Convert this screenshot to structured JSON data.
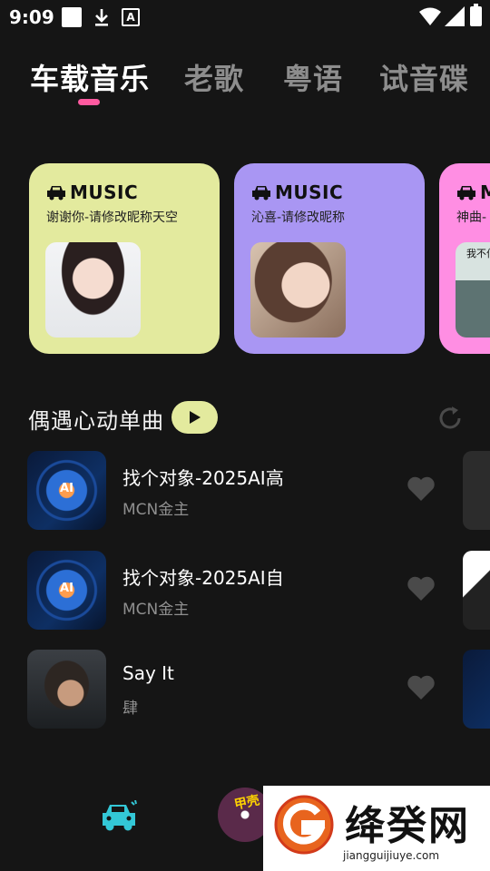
{
  "status_bar": {
    "time": "9:09",
    "icons": [
      "notification-square-icon",
      "download-icon",
      "text-a-icon",
      "wifi-icon",
      "signal-icon",
      "battery-icon"
    ]
  },
  "tabs": [
    {
      "label": "车载音乐",
      "active": true
    },
    {
      "label": "老歌",
      "active": false
    },
    {
      "label": "粤语",
      "active": false
    },
    {
      "label": "试音碟",
      "active": false
    }
  ],
  "colors": {
    "accent_pink": "#ff5aa0",
    "card_yellow": "#e3ea9e",
    "card_purple": "#a996f3",
    "card_pink": "#ff8ee3",
    "nav_active": "#33c7d6"
  },
  "playlists": [
    {
      "brand": "MUSIC",
      "subtitle": "谢谢你-请修改昵称天空"
    },
    {
      "brand": "MUSIC",
      "subtitle": "沁喜-请修改昵称"
    },
    {
      "brand": "MUSIC",
      "subtitle": "神曲-",
      "cover_text": "我不伯 只怕"
    }
  ],
  "section": {
    "title": "偶遇心动单曲"
  },
  "songs": [
    {
      "title": "找个对象-2025AI高",
      "artist": "MCN金主",
      "cover_text": "AI"
    },
    {
      "title": "找个对象-2025AI自",
      "artist": "MCN金主",
      "cover_text": "AI"
    },
    {
      "title": "Say It",
      "artist": "肆"
    }
  ],
  "bottom_nav": {
    "disc_text": "甲壳"
  },
  "watermark": {
    "name": "绛癸网",
    "url": "jiangguijiuye.com"
  }
}
